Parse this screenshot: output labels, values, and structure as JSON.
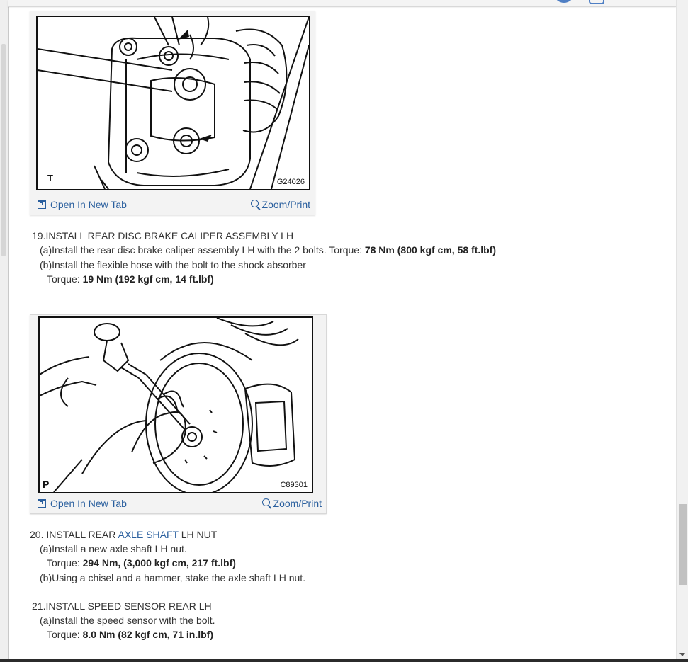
{
  "figures": [
    {
      "corner_label": "T",
      "code": "G24026",
      "open_label": "Open In New Tab",
      "zoom_label": "Zoom/Print"
    },
    {
      "corner_label": "P",
      "code": "C89301",
      "open_label": "Open In New Tab",
      "zoom_label": "Zoom/Print"
    }
  ],
  "step19": {
    "heading": "19.INSTALL REAR DISC BRAKE CALIPER ASSEMBLY LH",
    "a_text": "(a)Install the rear disc brake caliper assembly LH with the 2 bolts. Torque: ",
    "a_value": "78 Nm (800 kgf cm, 58 ft.lbf)",
    "b_text": "(b)Install the flexible hose with the bolt to the shock absorber",
    "b_torque_label": "Torque: ",
    "b_value": "19 Nm (192 kgf cm, 14 ft.lbf)"
  },
  "step20": {
    "heading_prefix": "20. INSTALL REAR ",
    "heading_link": "AXLE SHAFT",
    "heading_suffix": " LH NUT",
    "a_text": "(a)Install a new axle shaft LH nut.",
    "a_torque_label": "Torque: ",
    "a_value": "294 Nm, (3,000 kgf cm, 217 ft.lbf)",
    "b_text": "(b)Using a chisel and a hammer, stake the axle shaft LH nut."
  },
  "step21": {
    "heading": "21.INSTALL SPEED SENSOR REAR LH",
    "a_text": "(a)Install the speed sensor with the bolt.",
    "a_torque_label": "Torque: ",
    "a_value": "8.0 Nm (82 kgf cm, 71 in.lbf)"
  }
}
